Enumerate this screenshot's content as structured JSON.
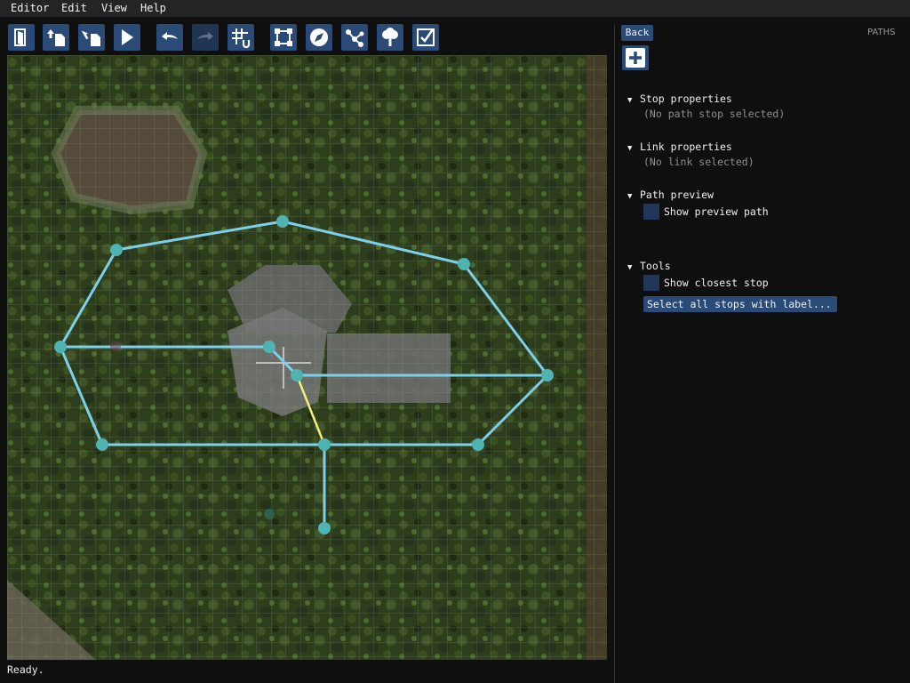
{
  "menu": {
    "items": [
      "Editor",
      "Edit",
      "View",
      "Help"
    ]
  },
  "toolbar": {
    "buttons": [
      {
        "icon": "exit-door-icon"
      },
      {
        "icon": "upload-icon"
      },
      {
        "icon": "save-file-icon"
      },
      {
        "icon": "play-icon"
      },
      {
        "icon": "undo-icon"
      },
      {
        "icon": "redo-icon",
        "disabled": true
      },
      {
        "icon": "grid-snap-icon"
      },
      {
        "icon": "selection-frame-icon"
      },
      {
        "icon": "compass-icon"
      },
      {
        "icon": "path-nodes-icon"
      },
      {
        "icon": "tree-icon"
      },
      {
        "icon": "checkbox-icon"
      }
    ]
  },
  "panel": {
    "back_label": "Back",
    "title": "PATHS",
    "add_icon": "plus-icon",
    "sections": {
      "stop": {
        "title": "Stop properties",
        "note": "(No path stop selected)"
      },
      "link": {
        "title": "Link properties",
        "note": "(No link selected)"
      },
      "preview": {
        "title": "Path preview",
        "checkbox_label": "Show preview path"
      },
      "tools": {
        "title": "Tools",
        "checkbox_label": "Show closest stop",
        "button_label": "Select all stops with label..."
      }
    }
  },
  "status": {
    "text": "Ready."
  },
  "colors": {
    "accent_button": "#2a4a78",
    "path_link": "#7cd0ec",
    "path_stop": "#4fb3b3",
    "selected_link": "#f0f07c",
    "grass": "#2c3a1a"
  }
}
